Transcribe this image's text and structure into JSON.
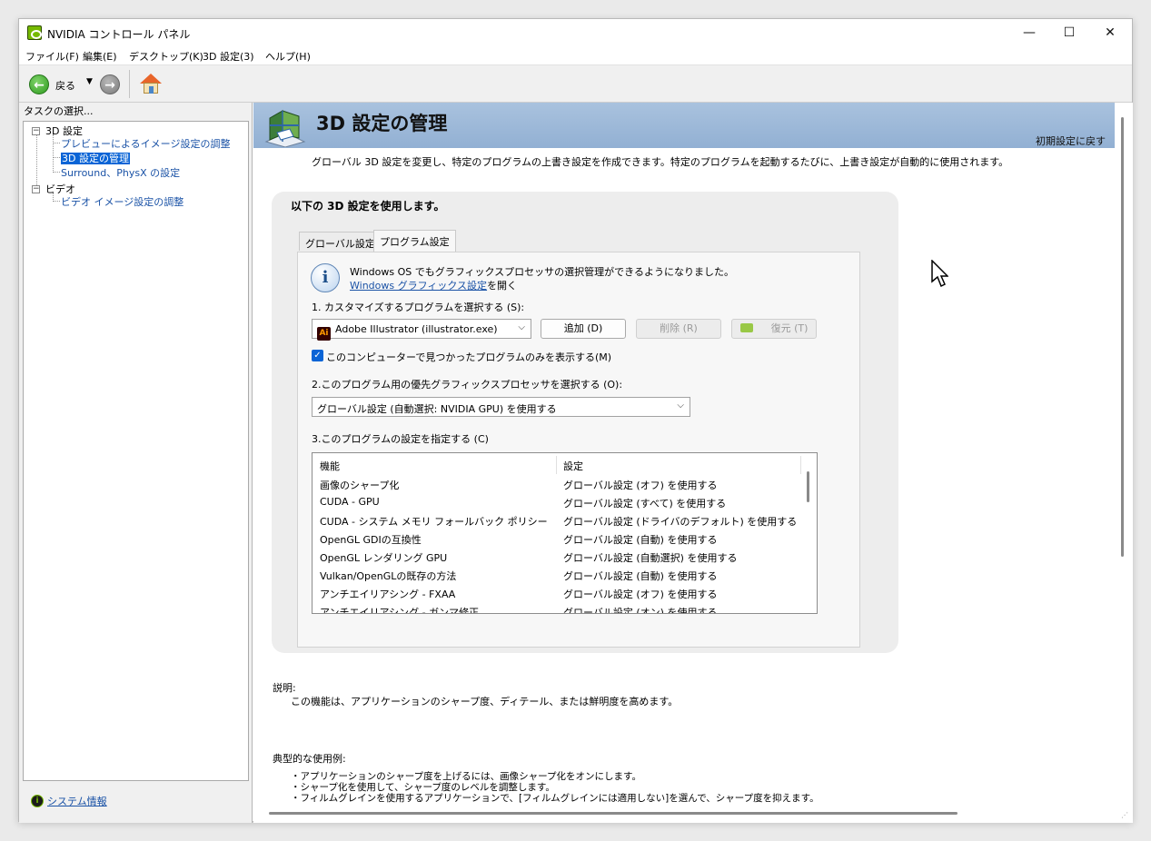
{
  "window": {
    "title": "NVIDIA コントロール パネル",
    "controls": {
      "minimize": "—",
      "maximize": "☐",
      "close": "✕"
    }
  },
  "menu": [
    "ファイル(F)",
    "編集(E)",
    "デスクトップ(K)",
    "3D 設定(3)",
    "ヘルプ(H)"
  ],
  "toolbar": {
    "back_label": "戻る",
    "dropdown_glyph": "▼",
    "back_glyph": "←",
    "forward_glyph": "→"
  },
  "sidebar": {
    "header": "タスクの選択...",
    "tree": [
      {
        "label": "3D 設定",
        "toggle": "−"
      },
      {
        "label": "プレビューによるイメージ設定の調整"
      },
      {
        "label": "3D 設定の管理"
      },
      {
        "label": "Surround、PhysX の設定"
      },
      {
        "label": "ビデオ",
        "toggle": "−"
      },
      {
        "label": "ビデオ イメージ設定の調整"
      }
    ],
    "system_info": "システム情報"
  },
  "page": {
    "title": "3D 設定の管理",
    "reset_link": "初期設定に戻す",
    "intro": "グローバル 3D 設定を変更し、特定のプログラムの上書き設定を作成できます。特定のプログラムを起動するたびに、上書き設定が自動的に使用されます。",
    "section_heading": "以下の 3D 設定を使用します。",
    "tabs": [
      "グローバル設定",
      "プログラム設定"
    ],
    "active_tab": "プログラム設定",
    "info": {
      "line1": "Windows OS でもグラフィックスプロセッサの選択管理ができるようになりました。",
      "link": "Windows グラフィックス設定",
      "link_suffix": "を開く"
    },
    "step1": {
      "label": "1. カスタマイズするプログラムを選択する (S):",
      "selected_program": "Adobe Illustrator (illustrator.exe)",
      "program_icon": "Ai",
      "add_button": "追加 (D)",
      "remove_button": "削除 (R)",
      "restore_button": "復元 (T)",
      "checkbox_label": "このコンピューターで見つかったプログラムのみを表示する(M)",
      "checkbox_checked": true
    },
    "step2": {
      "label": "2.このプログラム用の優先グラフィックスプロセッサを選択する (O):",
      "selected": "グローバル設定 (自動選択: NVIDIA GPU) を使用する"
    },
    "step3": {
      "label": "3.このプログラムの設定を指定する (C)",
      "columns": [
        "機能",
        "設定"
      ],
      "rows": [
        [
          "画像のシャープ化",
          "グローバル設定 (オフ) を使用する"
        ],
        [
          "CUDA - GPU",
          "グローバル設定 (すべて) を使用する"
        ],
        [
          "CUDA - システム メモリ フォールバック ポリシー",
          "グローバル設定 (ドライバのデフォルト) を使用する"
        ],
        [
          "OpenGL GDIの互換性",
          "グローバル設定 (自動) を使用する"
        ],
        [
          "OpenGL レンダリング GPU",
          "グローバル設定 (自動選択) を使用する"
        ],
        [
          "Vulkan/OpenGLの既存の方法",
          "グローバル設定 (自動) を使用する"
        ],
        [
          "アンチエイリアシング - FXAA",
          "グローバル設定 (オフ) を使用する"
        ],
        [
          "アンチエイリアシング - ガンマ修正",
          "グローバル設定 (オン) を使用する"
        ]
      ]
    },
    "description_label": "説明:",
    "description_text": "この機能は、アプリケーションのシャープ度、ディテール、または鮮明度を高めます。",
    "usage_label": "典型的な使用例:",
    "usage_items": [
      "・アプリケーションのシャープ度を上げるには、画像シャープ化をオンにします。",
      "・シャープ化を使用して、シャープ度のレベルを調整します。",
      "・フィルムグレインを使用するアプリケーションで、[フィルムグレインには適用しない]を選んで、シャープ度を抑えます。"
    ]
  }
}
